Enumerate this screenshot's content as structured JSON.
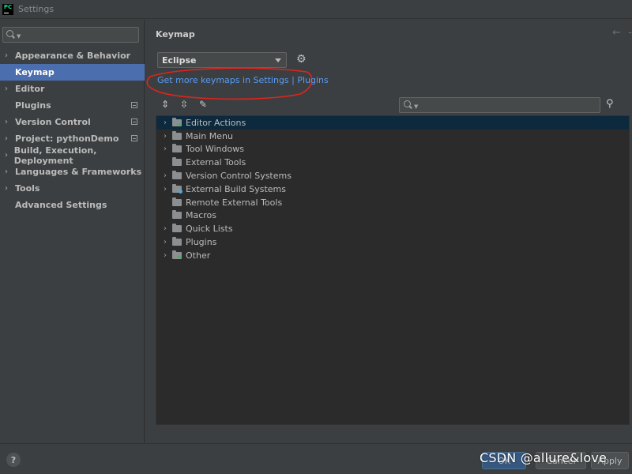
{
  "window": {
    "title": "Settings",
    "app_icon_label": "PC"
  },
  "sidebar": {
    "search_placeholder": "",
    "items": [
      {
        "label": "Appearance & Behavior",
        "expandable": true,
        "badge": false,
        "selected": false
      },
      {
        "label": "Keymap",
        "expandable": false,
        "badge": false,
        "selected": true
      },
      {
        "label": "Editor",
        "expandable": true,
        "badge": false,
        "selected": false
      },
      {
        "label": "Plugins",
        "expandable": false,
        "badge": true,
        "selected": false
      },
      {
        "label": "Version Control",
        "expandable": true,
        "badge": true,
        "selected": false
      },
      {
        "label": "Project: pythonDemo",
        "expandable": true,
        "badge": true,
        "selected": false
      },
      {
        "label": "Build, Execution, Deployment",
        "expandable": true,
        "badge": false,
        "selected": false
      },
      {
        "label": "Languages & Frameworks",
        "expandable": true,
        "badge": false,
        "selected": false
      },
      {
        "label": "Tools",
        "expandable": true,
        "badge": false,
        "selected": false
      },
      {
        "label": "Advanced Settings",
        "expandable": false,
        "badge": false,
        "selected": false
      }
    ]
  },
  "main": {
    "title": "Keymap",
    "keymap_value": "Eclipse",
    "link_part1": "Get more keymaps in Settings",
    "link_sep": " | ",
    "link_part2": "Plugins",
    "tree": [
      {
        "label": "Editor Actions",
        "expandable": true,
        "selected": true,
        "icon": "editor-actions-icon"
      },
      {
        "label": "Main Menu",
        "expandable": true,
        "selected": false,
        "icon": "main-menu-icon"
      },
      {
        "label": "Tool Windows",
        "expandable": true,
        "selected": false,
        "icon": "folder-icon"
      },
      {
        "label": "External Tools",
        "expandable": false,
        "selected": false,
        "icon": "folder-icon"
      },
      {
        "label": "Version Control Systems",
        "expandable": true,
        "selected": false,
        "icon": "folder-icon"
      },
      {
        "label": "External Build Systems",
        "expandable": true,
        "selected": false,
        "icon": "build-systems-icon"
      },
      {
        "label": "Remote External Tools",
        "expandable": false,
        "selected": false,
        "icon": "folder-icon"
      },
      {
        "label": "Macros",
        "expandable": false,
        "selected": false,
        "icon": "folder-icon"
      },
      {
        "label": "Quick Lists",
        "expandable": true,
        "selected": false,
        "icon": "folder-icon"
      },
      {
        "label": "Plugins",
        "expandable": true,
        "selected": false,
        "icon": "folder-icon"
      },
      {
        "label": "Other",
        "expandable": true,
        "selected": false,
        "icon": "other-icon"
      }
    ]
  },
  "footer": {
    "help_label": "?",
    "ok_label": "OK",
    "cancel_label": "Cancel",
    "apply_label": "Apply",
    "watermark": "CSDN @allure&love"
  },
  "colors": {
    "accent_selection": "#4b6eaf",
    "link": "#589df6",
    "annotation_red": "#e0241c"
  }
}
